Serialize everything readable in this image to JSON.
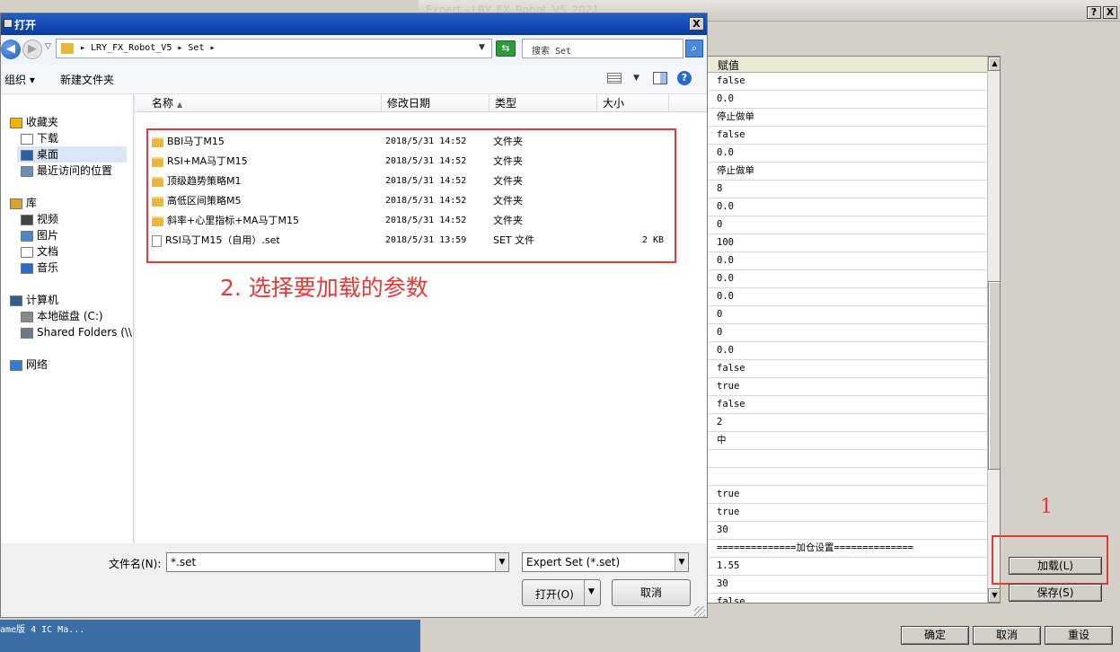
{
  "background_window": {
    "title": "Expert - LRY_FX_Robot_V5_2021",
    "help_label": "?",
    "close_label": "X",
    "value_column_header": "赋值",
    "values": [
      "false",
      "0.0",
      "停止做单",
      "false",
      "0.0",
      "停止做单",
      "8",
      "0.0",
      "0",
      "100",
      "0.0",
      "0.0",
      "0.0",
      "0",
      "0",
      "0.0",
      "false",
      "true",
      "false",
      "2",
      "中",
      "",
      "",
      "true",
      "true",
      "30",
      "==============加仓设置==============",
      "1.55",
      "30",
      "false"
    ],
    "load_label": "加载(L)",
    "save_label": "保存(S)",
    "ok_label": "确定",
    "cancel_label": "取消",
    "reset_label": "重设",
    "annotation_1": "1"
  },
  "taskbar": {
    "text": "ame版     4 IC Ma..."
  },
  "dialog": {
    "title": "打开",
    "close_label": "X",
    "address_path": "▸ LRY_FX_Robot_V5 ▸ Set ▸",
    "search_placeholder": "搜索 Set",
    "toolbar": {
      "organize": "组织 ▾",
      "new_folder": "新建文件夹"
    },
    "nav_items": [
      {
        "label": "收藏夹",
        "icon": "star-icon"
      },
      {
        "label": "下载",
        "icon": "download-icon"
      },
      {
        "label": "桌面",
        "icon": "desktop-icon"
      },
      {
        "label": "最近访问的位置",
        "icon": "recent-icon"
      },
      {
        "label": "库",
        "icon": "library-icon"
      },
      {
        "label": "视频",
        "icon": "video-icon"
      },
      {
        "label": "图片",
        "icon": "picture-icon"
      },
      {
        "label": "文档",
        "icon": "document-icon"
      },
      {
        "label": "音乐",
        "icon": "music-icon"
      },
      {
        "label": "计算机",
        "icon": "computer-icon"
      },
      {
        "label": "本地磁盘 (C:)",
        "icon": "disk-icon"
      },
      {
        "label": "Shared Folders (\\\\",
        "icon": "network-drive-icon"
      },
      {
        "label": "网络",
        "icon": "network-icon"
      }
    ],
    "columns": {
      "name": "名称",
      "date": "修改日期",
      "type": "类型",
      "size": "大小"
    },
    "files": [
      {
        "name": "BBI马丁M15",
        "date": "2018/5/31 14:52",
        "type": "文件夹",
        "size": "",
        "icon": "folder-icon"
      },
      {
        "name": "RSI+MA马丁M15",
        "date": "2018/5/31 14:52",
        "type": "文件夹",
        "size": "",
        "icon": "folder-icon"
      },
      {
        "name": "顶级趋势策略M1",
        "date": "2018/5/31 14:52",
        "type": "文件夹",
        "size": "",
        "icon": "folder-icon"
      },
      {
        "name": "高低区间策略M5",
        "date": "2018/5/31 14:52",
        "type": "文件夹",
        "size": "",
        "icon": "folder-icon"
      },
      {
        "name": "斜率+心里指标+MA马丁M15",
        "date": "2018/5/31 14:52",
        "type": "文件夹",
        "size": "",
        "icon": "folder-icon"
      },
      {
        "name": "RSI马丁M15（自用）.set",
        "date": "2018/5/31 13:59",
        "type": "SET 文件",
        "size": "2 KB",
        "icon": "set-file-icon"
      }
    ],
    "annotation_2": "2. 选择要加载的参数",
    "filename_label": "文件名(N):",
    "filename_value": "*.set",
    "filetype_value": "Expert Set (*.set)",
    "open_label": "打开(O)",
    "cancel_label": "取消"
  },
  "colors": {
    "annotation_red": "#e53935",
    "titlebar_blue": "#0a3aa0",
    "folder_yellow": "#e9b73c"
  }
}
